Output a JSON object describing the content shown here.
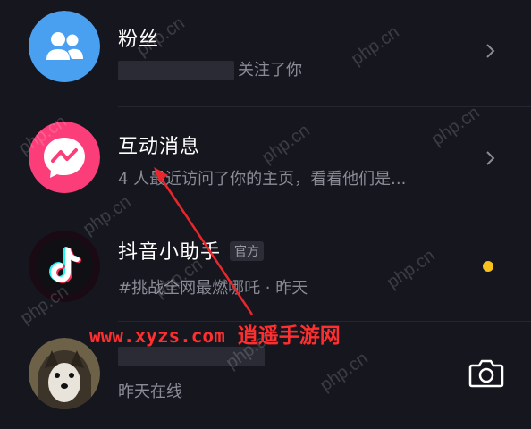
{
  "messages": [
    {
      "title": "粉丝",
      "subtitle": "关注了你",
      "icon": "fans-icon",
      "color": "#4aa0f0"
    },
    {
      "title": "互动消息",
      "subtitle": "4 人最近访问了你的主页，看看他们是...",
      "icon": "message-bubble-icon",
      "color": "#fb3e7a"
    },
    {
      "title": "抖音小助手",
      "badge": "官方",
      "subtitle": "#挑战全网最燃哪吒 · 昨天",
      "icon": "douyin-logo-icon"
    },
    {
      "subtitle": "昨天在线",
      "icon": "dog-avatar"
    }
  ],
  "annotation": {
    "url": "www.xyzs.com",
    "name": "逍遥手游网",
    "color": "#ff2f2f"
  },
  "watermark": "php.cn"
}
